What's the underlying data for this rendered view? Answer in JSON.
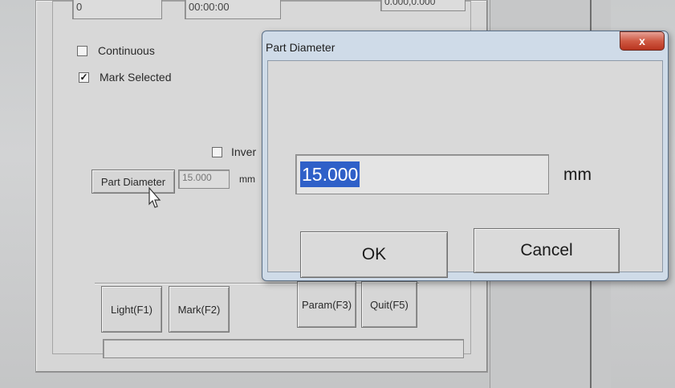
{
  "main": {
    "counter_value": "0",
    "time_value": "00:00:00",
    "coord_value": "0.000,0.000",
    "continuous": {
      "label": "Continuous",
      "checked": false
    },
    "mark_selected": {
      "label": "Mark Selected",
      "checked": true
    },
    "invert": {
      "label": "Inver",
      "checked": false
    },
    "part_diameter_button": "Part Diameter",
    "part_diameter_value": "15.000",
    "part_diameter_unit": "mm",
    "buttons": {
      "light": "Light(F1)",
      "mark": "Mark(F2)",
      "param": "Param(F3)",
      "quit": "Quit(F5)"
    }
  },
  "dialog": {
    "title": "Part Diameter",
    "close_glyph": "x",
    "value": "15.000",
    "unit": "mm",
    "ok_label": "OK",
    "cancel_label": "Cancel"
  },
  "icons": {
    "cursor": "mouse-pointer-icon",
    "close": "close-icon",
    "check": "checkmark-icon"
  },
  "colors": {
    "selection": "#2f60c8",
    "close_button": "#cf5a44",
    "dialog_frame": "#cfdbe8"
  }
}
